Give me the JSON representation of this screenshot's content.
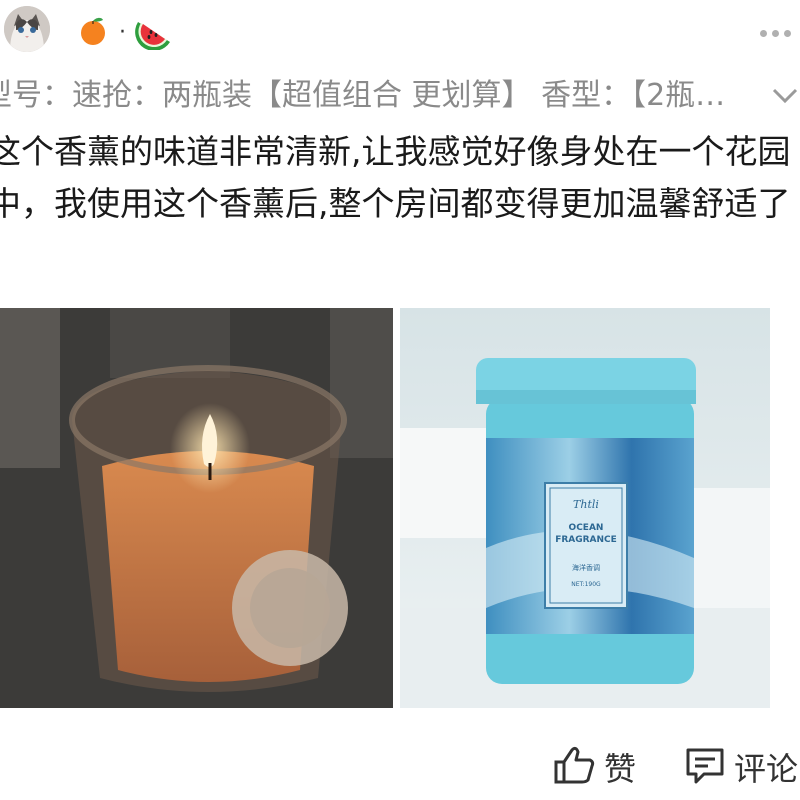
{
  "header": {
    "avatar_icon": "cat-avatar-icon",
    "badges": [
      "orange-emoji-icon",
      "watermelon-emoji-icon"
    ],
    "badge_separator": "·",
    "more_icon": "more-dots-icon"
  },
  "specs_line": "型号：速抢：两瓶装【超值组合 更划算】 香型：【2瓶…",
  "review_text": "这个香薰的味道非常清新,让我感觉好像身处在一个花园中，我使用这个香薰后,整个房间都变得更加温馨舒适了",
  "photos": [
    {
      "name": "candle-photo"
    },
    {
      "name": "ocean-fragrance-photo",
      "label_brand": "Thtli",
      "label_title_1": "OCEAN",
      "label_title_2": "FRAGRANCE",
      "label_cn": "海洋香调",
      "label_net": "NET:190G"
    }
  ],
  "actions": {
    "like_label": "赞",
    "comment_label": "评论"
  }
}
